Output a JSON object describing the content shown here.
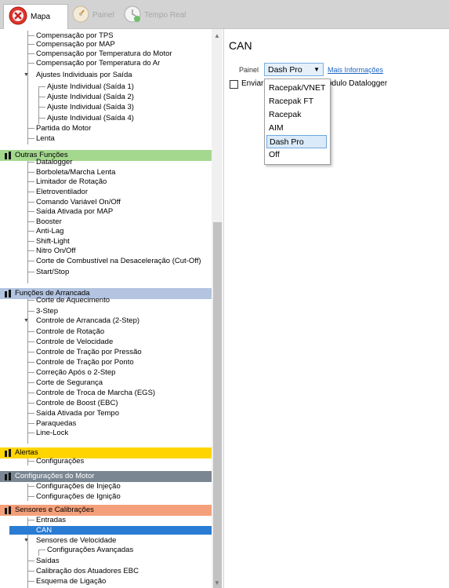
{
  "tabs": [
    {
      "label": "Mapa",
      "active": true
    },
    {
      "label": "Painel",
      "active": false
    },
    {
      "label": "Tempo Real",
      "active": false
    }
  ],
  "tree_top": [
    "Compensação por TPS",
    "Compensação por MAP",
    "Compensação por Temperatura do Motor",
    "Compensação por Temperatura do Ar",
    "Ajustes Individuais por Saída",
    "Ajuste Individual (Saída 1)",
    "Ajuste Individual (Saída 2)",
    "Ajuste Individual (Saída 3)",
    "Ajuste Individual (Saída 4)",
    "Partida do Motor",
    "Lenta"
  ],
  "cat_outras": {
    "label": "Outras Funções",
    "color": "#a4d88e"
  },
  "outras_items": [
    "Datalogger",
    "Borboleta/Marcha Lenta",
    "Limitador de Rotação",
    "Eletroventilador",
    "Comando Variável On/Off",
    "Saída Ativada por MAP",
    "Booster",
    "Anti-Lag",
    "Shift-Light",
    "Nitro On/Off",
    "Corte de Combustível na Desaceleração (Cut-Off)",
    "Start/Stop"
  ],
  "cat_arrancada": {
    "label": "Funções de Arrancada",
    "color": "#b2c4e0"
  },
  "arrancada_items": [
    "Corte de Aquecimento",
    "3-Step",
    "Controle de Arrancada (2-Step)",
    "Controle de Rotação",
    "Controle de Velocidade",
    "Controle de Tração por Pressão",
    "Controle de Tração por Ponto",
    "Correção Após o 2-Step",
    "Corte de Segurança",
    "Controle de Troca de Marcha (EGS)",
    "Controle de Boost (EBC)",
    "Saída Ativada por Tempo",
    "Paraquedas",
    "Line-Lock"
  ],
  "cat_alertas": {
    "label": "Alertas",
    "color": "#ffd500"
  },
  "alertas_items": [
    "Configurações"
  ],
  "cat_motor": {
    "label": "Configurações do Motor",
    "color": "#7a8692"
  },
  "motor_items": [
    "Configurações de Injeção",
    "Configurações de Ignição"
  ],
  "cat_sensores": {
    "label": "Sensores e Calibrações",
    "color": "#f4a07a"
  },
  "sensores_items": [
    "Entradas",
    "CAN",
    "Sensores de Velocidade",
    "Configurações Avançadas",
    "Saídas",
    "Calibração dos Atuadores EBC",
    "Esquema de Ligação"
  ],
  "panel": {
    "title": "CAN",
    "painel_label": "Painel",
    "painel_value": "Dash Pro",
    "more_info": "Mais Informações",
    "checkbox_label_a": "Enviar",
    "checkbox_label_b": "ódulo Datalogger"
  },
  "dropdown_options": [
    "Racepak/VNET",
    "Racepak FT",
    "Racepak",
    "AIM",
    "Dash Pro",
    "Off"
  ],
  "dropdown_selected": "Dash Pro"
}
